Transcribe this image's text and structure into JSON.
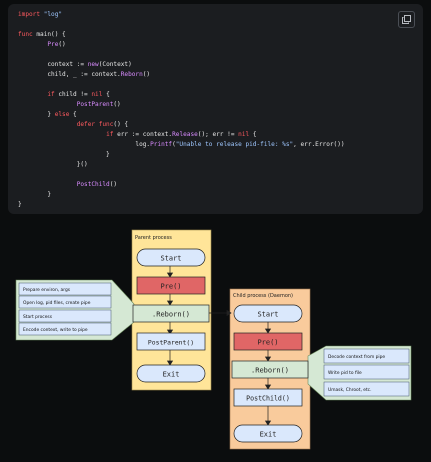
{
  "code": {
    "lines": [
      [
        [
          "kw",
          "import"
        ],
        [
          "t",
          " "
        ],
        [
          "str",
          "\"log\""
        ]
      ],
      [],
      [
        [
          "kw",
          "func"
        ],
        [
          "t",
          " main() {"
        ]
      ],
      [
        [
          "t",
          "        "
        ],
        [
          "fn",
          "Pre"
        ],
        [
          "t",
          "()"
        ]
      ],
      [],
      [
        [
          "t",
          "        context := "
        ],
        [
          "fn",
          "new"
        ],
        [
          "t",
          "(Context)"
        ]
      ],
      [
        [
          "t",
          "        child, _ := context."
        ],
        [
          "fn",
          "Reborn"
        ],
        [
          "t",
          "()"
        ]
      ],
      [],
      [
        [
          "t",
          "        "
        ],
        [
          "kw",
          "if"
        ],
        [
          "t",
          " child != "
        ],
        [
          "kw",
          "nil"
        ],
        [
          "t",
          " {"
        ]
      ],
      [
        [
          "t",
          "                "
        ],
        [
          "fn",
          "PostParent"
        ],
        [
          "t",
          "()"
        ]
      ],
      [
        [
          "t",
          "        } "
        ],
        [
          "kw",
          "else"
        ],
        [
          "t",
          " {"
        ]
      ],
      [
        [
          "t",
          "                "
        ],
        [
          "kw",
          "defer"
        ],
        [
          "t",
          " "
        ],
        [
          "kw",
          "func"
        ],
        [
          "t",
          "() {"
        ]
      ],
      [
        [
          "t",
          "                        "
        ],
        [
          "kw",
          "if"
        ],
        [
          "t",
          " err := context."
        ],
        [
          "fn",
          "Release"
        ],
        [
          "t",
          "(); err != "
        ],
        [
          "kw",
          "nil"
        ],
        [
          "t",
          " {"
        ]
      ],
      [
        [
          "t",
          "                                log."
        ],
        [
          "fn",
          "Printf"
        ],
        [
          "t",
          "("
        ],
        [
          "str",
          "\"Unable to release pid-file: %s\""
        ],
        [
          "t",
          ", err.Error())"
        ]
      ],
      [
        [
          "t",
          "                        }"
        ]
      ],
      [
        [
          "t",
          "                }()"
        ]
      ],
      [],
      [
        [
          "t",
          "                "
        ],
        [
          "fn",
          "PostChild"
        ],
        [
          "t",
          "()"
        ]
      ],
      [
        [
          "t",
          "        }"
        ]
      ],
      [
        [
          "t",
          "}"
        ]
      ]
    ]
  },
  "copy_icon": "copy-icon",
  "diagram": {
    "parent_title": "Parent process",
    "child_title": "Child process (Daemon)",
    "parent_nodes": {
      "start": "Start",
      "pre": "Pre()",
      "reborn": ".Reborn()",
      "post": "PostParent()",
      "exit": "Exit"
    },
    "child_nodes": {
      "start": "Start",
      "pre": "Pre()",
      "reborn": ".Reborn()",
      "post": "PostChild()",
      "exit": "Exit"
    },
    "left_notes": [
      "Prepare environ, args",
      "Open log, pid files, create pipe",
      "Start process",
      "Encode context, write to pipe"
    ],
    "right_notes": [
      "Decode context from pipe",
      "Write pid to file",
      "Umask, Chroot, etc."
    ],
    "colors": {
      "parent_bg": "#ffe599",
      "child_bg": "#f9cb9c",
      "start_exit": "#dae8fc",
      "pre": "#e06666",
      "reborn": "#d5e8d4",
      "callout": "#d5e8d4"
    }
  }
}
